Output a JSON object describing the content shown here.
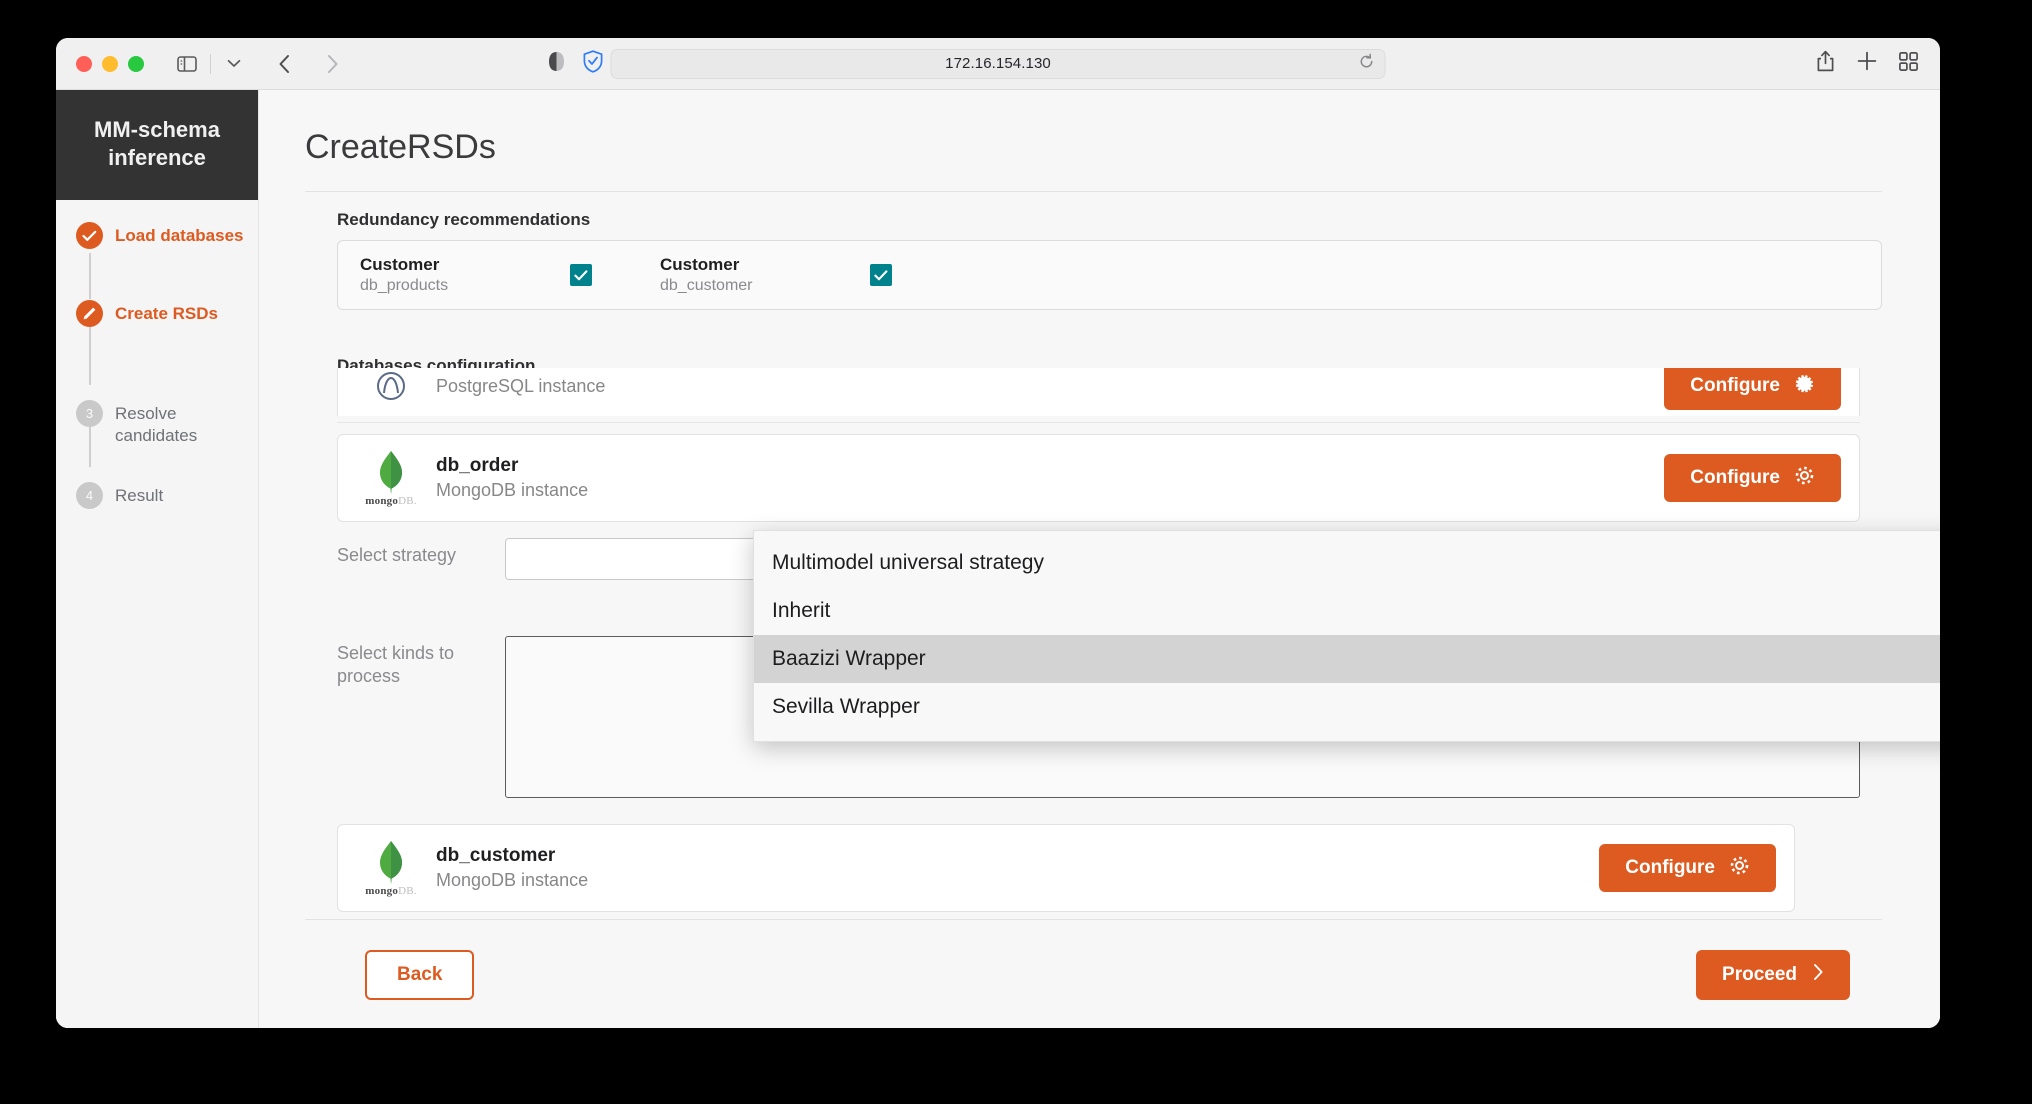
{
  "browser": {
    "url": "172.16.154.130",
    "icons": {
      "sidebar_toggle": "sidebar-toggle-icon",
      "tab_group_chevron": "chevron-down-icon",
      "back": "back-arrow-icon",
      "forward": "forward-arrow-icon",
      "reader": "reader-mode-icon",
      "privacy_shield": "shield-check-icon",
      "reload": "reload-icon",
      "share": "share-icon",
      "new_tab": "plus-icon",
      "tab_overview": "tab-overview-icon"
    }
  },
  "sidebar": {
    "brand_line1": "MM-schema",
    "brand_line2": "inference",
    "steps": [
      {
        "label": "Load databases",
        "state": "done",
        "marker": "check"
      },
      {
        "label": "Create RSDs",
        "state": "active",
        "marker": "pencil"
      },
      {
        "label": "Resolve candidates",
        "state": "pending",
        "marker": "3"
      },
      {
        "label": "Result",
        "state": "pending",
        "marker": "4"
      }
    ]
  },
  "main": {
    "title": "CreateRSDs",
    "redundancy": {
      "section_label": "Redundancy recommendations",
      "items": [
        {
          "title": "Customer",
          "subtitle": "db_products",
          "checked": true
        },
        {
          "title": "Customer",
          "subtitle": "db_customer",
          "checked": true
        }
      ]
    },
    "databases": {
      "section_label": "Databases configuration",
      "rows": [
        {
          "name": "",
          "kind": "PostgreSQL instance",
          "configure_label": "Configure",
          "logo": "postgresql-logo",
          "clipped": true
        },
        {
          "name": "db_order",
          "kind": "MongoDB instance",
          "configure_label": "Configure",
          "logo": "mongodb-logo",
          "expanded": true
        },
        {
          "name": "db_customer",
          "kind": "MongoDB instance",
          "configure_label": "Configure",
          "logo": "mongodb-logo"
        }
      ],
      "mongo_wordmark_bold": "mongo",
      "mongo_wordmark_light": "DB."
    },
    "config_panel": {
      "strategy_label": "Select strategy",
      "strategy_value": "",
      "kinds_label": "Select kinds to process",
      "kinds_value": ""
    },
    "dropdown": {
      "options": [
        {
          "label": "Multimodel universal strategy",
          "highlighted": false
        },
        {
          "label": "Inherit",
          "highlighted": false
        },
        {
          "label": "Baazizi Wrapper",
          "highlighted": true
        },
        {
          "label": "Sevilla Wrapper",
          "highlighted": false
        }
      ]
    },
    "footer": {
      "back_label": "Back",
      "proceed_label": "Proceed"
    }
  },
  "colors": {
    "accent_orange": "#dd5b21",
    "checkbox_teal": "#00828c",
    "sidebar_brand_bg": "#333333",
    "dropdown_highlight": "#d3d3d3"
  }
}
